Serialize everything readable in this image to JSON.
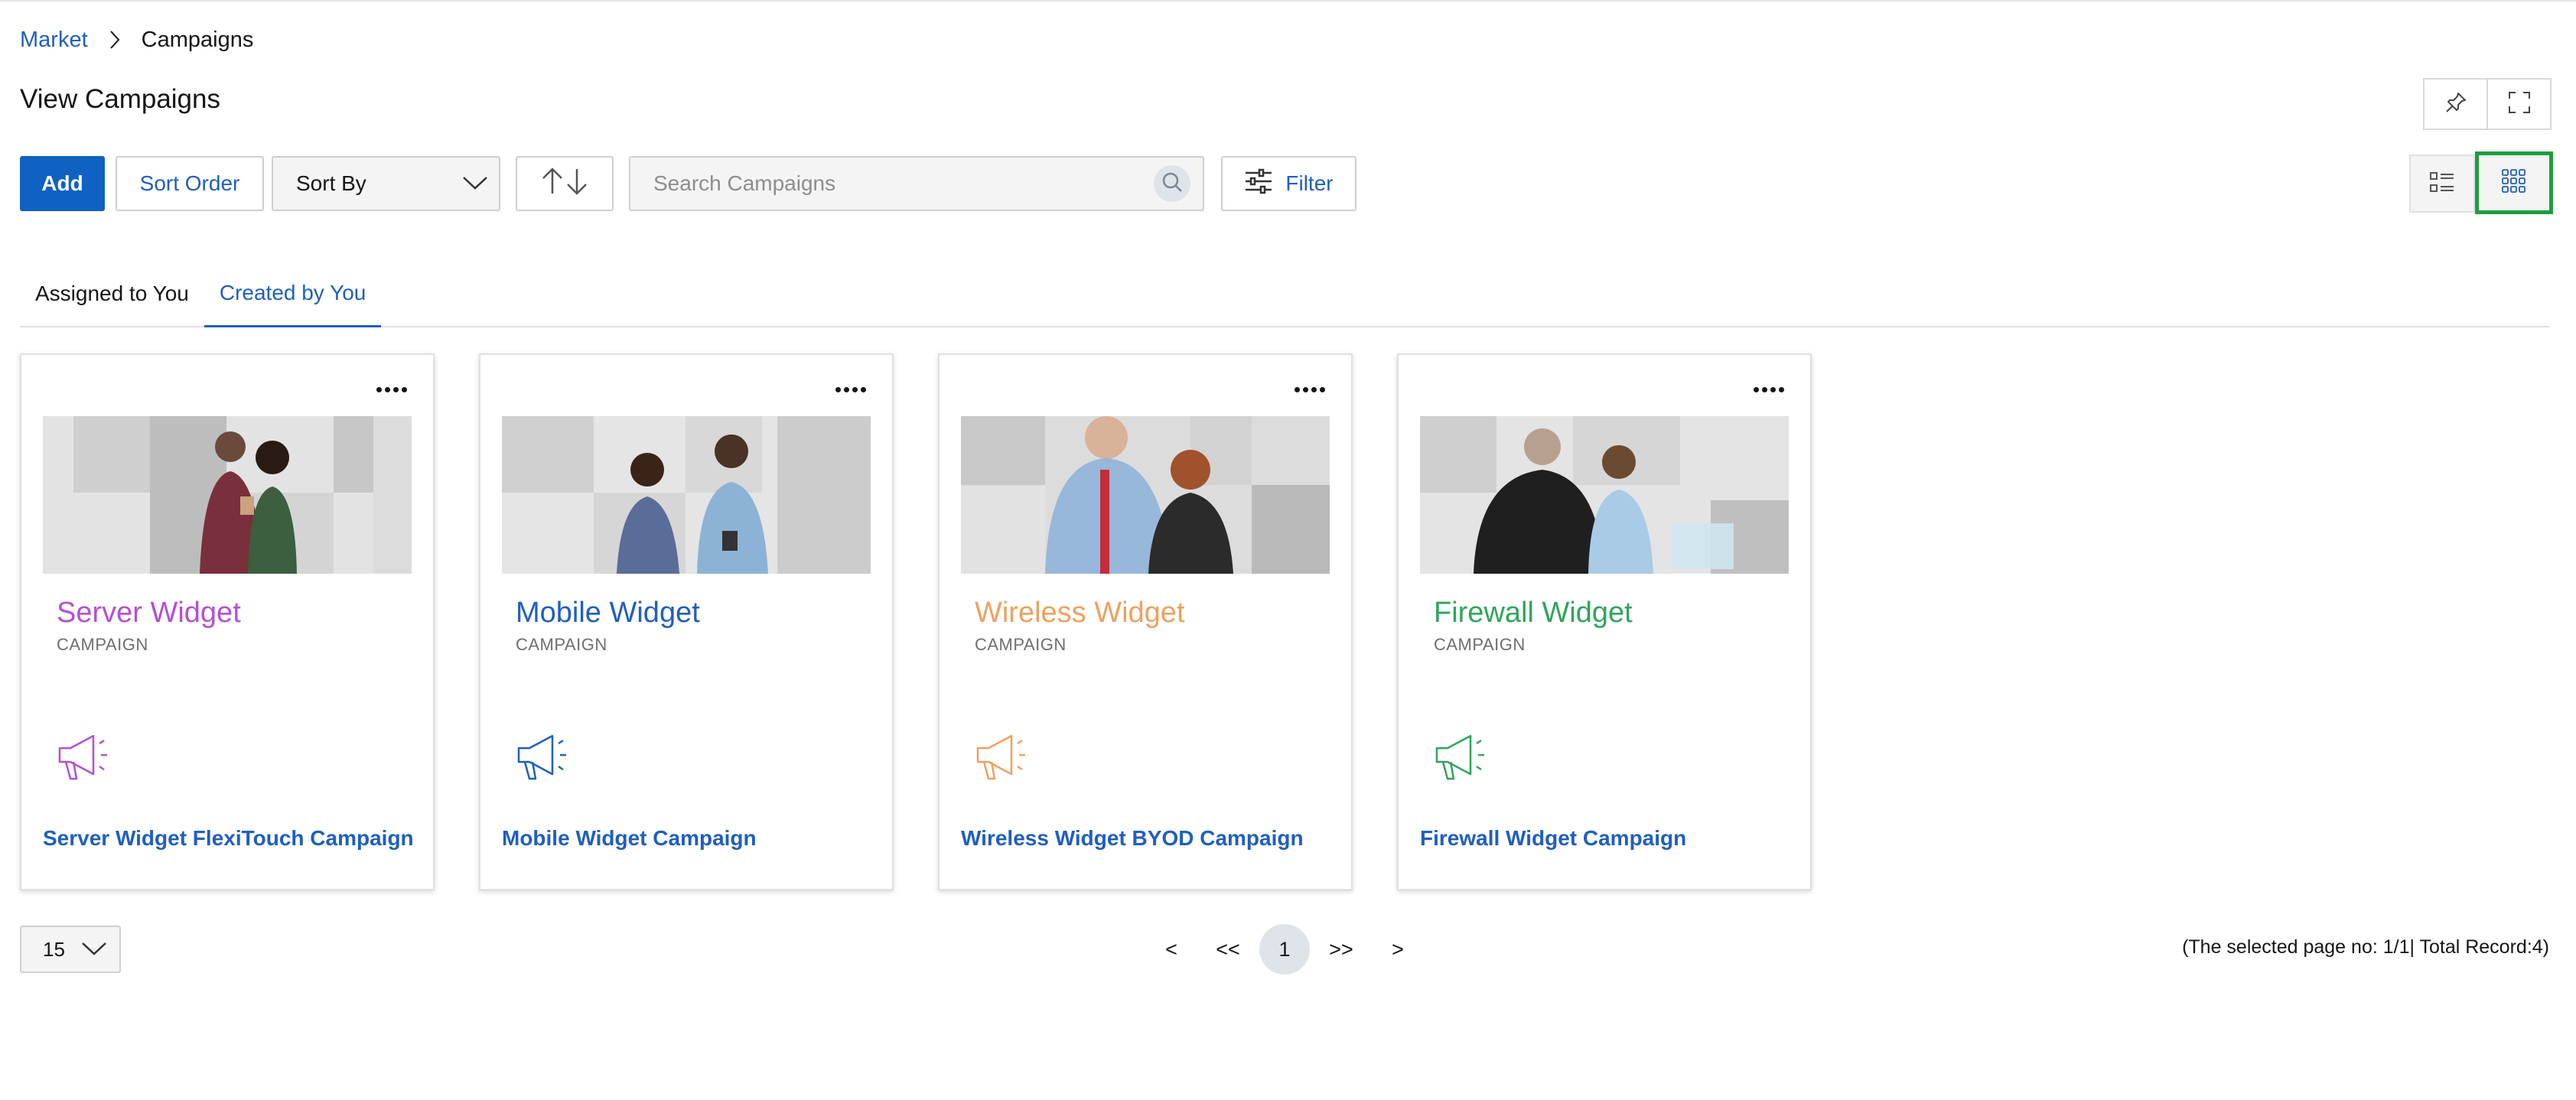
{
  "breadcrumb": {
    "root": "Market",
    "current": "Campaigns"
  },
  "page_title": "View Campaigns",
  "toolbar": {
    "add_label": "Add",
    "sort_order_label": "Sort Order",
    "sort_by_label": "Sort By",
    "search_placeholder": "Search Campaigns",
    "filter_label": "Filter"
  },
  "tabs": [
    {
      "label": "Assigned to You",
      "active": false
    },
    {
      "label": "Created by You",
      "active": true
    }
  ],
  "cards": [
    {
      "title": "Server Widget",
      "type": "CAMPAIGN",
      "link": "Server Widget FlexiTouch Campaign",
      "color": "#b44fd6"
    },
    {
      "title": "Mobile Widget",
      "type": "CAMPAIGN",
      "link": "Mobile Widget Campaign",
      "color": "#1f5fbf"
    },
    {
      "title": "Wireless Widget",
      "type": "CAMPAIGN",
      "link": "Wireless Widget BYOD Campaign",
      "color": "#f0a05f"
    },
    {
      "title": "Firewall Widget",
      "type": "CAMPAIGN",
      "link": "Firewall Widget Campaign",
      "color": "#2fa55a"
    }
  ],
  "pagination": {
    "per_page": "15",
    "prev": "<",
    "first": "<<",
    "current": "1",
    "last": ">>",
    "next": ">",
    "info": "(The selected page no: 1/1| Total Record:4)"
  },
  "icons": {
    "pin": "pin-icon",
    "fullscreen": "fullscreen-icon",
    "list_view": "list-view-icon",
    "grid_view": "grid-view-icon",
    "search": "search-icon",
    "filter": "filter-icon",
    "megaphone": "megaphone-icon"
  },
  "colors": {
    "primary": "#0f62c2",
    "link": "#1f5fbf",
    "selected_outline": "#1e9e3e"
  }
}
